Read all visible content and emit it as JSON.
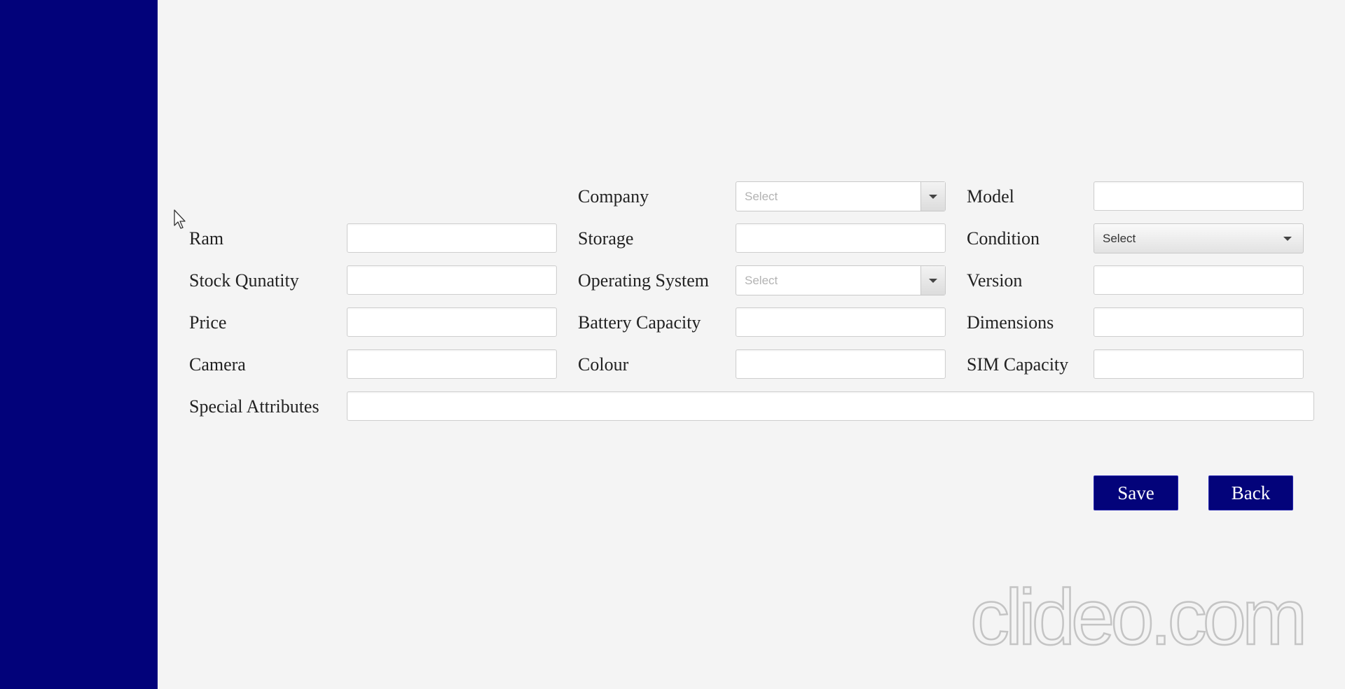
{
  "form": {
    "labels": {
      "company": "Company",
      "model": "Model",
      "ram": "Ram",
      "storage": "Storage",
      "condition": "Condition",
      "stock_quantity": "Stock Qunatity",
      "operating_system": "Operating System",
      "version": "Version",
      "price": "Price",
      "battery_capacity": "Battery Capacity",
      "dimensions": "Dimensions",
      "camera": "Camera",
      "colour": "Colour",
      "sim_capacity": "SIM Capacity",
      "special_attributes": "Special Attributes"
    },
    "values": {
      "model": "",
      "ram": "",
      "storage": "",
      "stock_quantity": "",
      "version": "",
      "price": "",
      "battery_capacity": "",
      "dimensions": "",
      "camera": "",
      "colour": "",
      "sim_capacity": "",
      "special_attributes": ""
    },
    "selects": {
      "company": "Select",
      "condition": "Select",
      "operating_system": "Select"
    }
  },
  "actions": {
    "save_label": "Save",
    "back_label": "Back"
  },
  "watermark": "clideo.com",
  "colors": {
    "sidebar": "#02027a",
    "button": "#03037a",
    "background": "#f4f4f4"
  }
}
